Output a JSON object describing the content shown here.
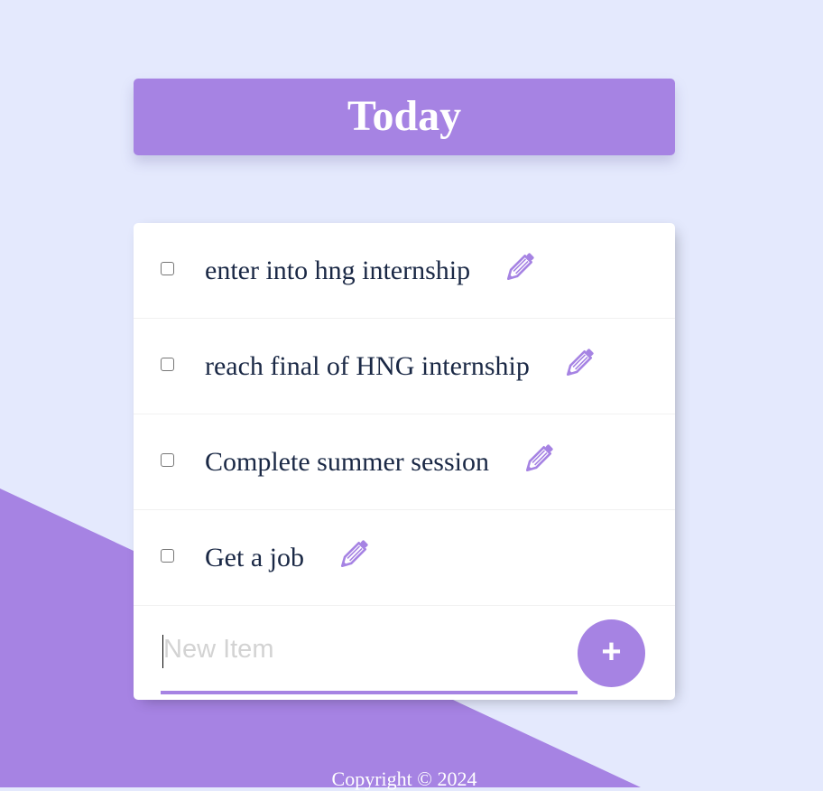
{
  "header": {
    "title": "Today"
  },
  "todo": {
    "items": [
      {
        "label": "enter into hng internship",
        "checked": false
      },
      {
        "label": "reach final of HNG internship",
        "checked": false
      },
      {
        "label": "Complete summer session",
        "checked": false
      },
      {
        "label": "Get a job",
        "checked": false
      }
    ],
    "edit_icon": "pencil-icon"
  },
  "new_item": {
    "value": "",
    "placeholder": "New Item",
    "add_label": "+"
  },
  "footer": {
    "copyright": "Copyright © 2024"
  },
  "colors": {
    "accent": "#A683E3",
    "background": "#E4E9FD",
    "text": "#1A2845"
  }
}
